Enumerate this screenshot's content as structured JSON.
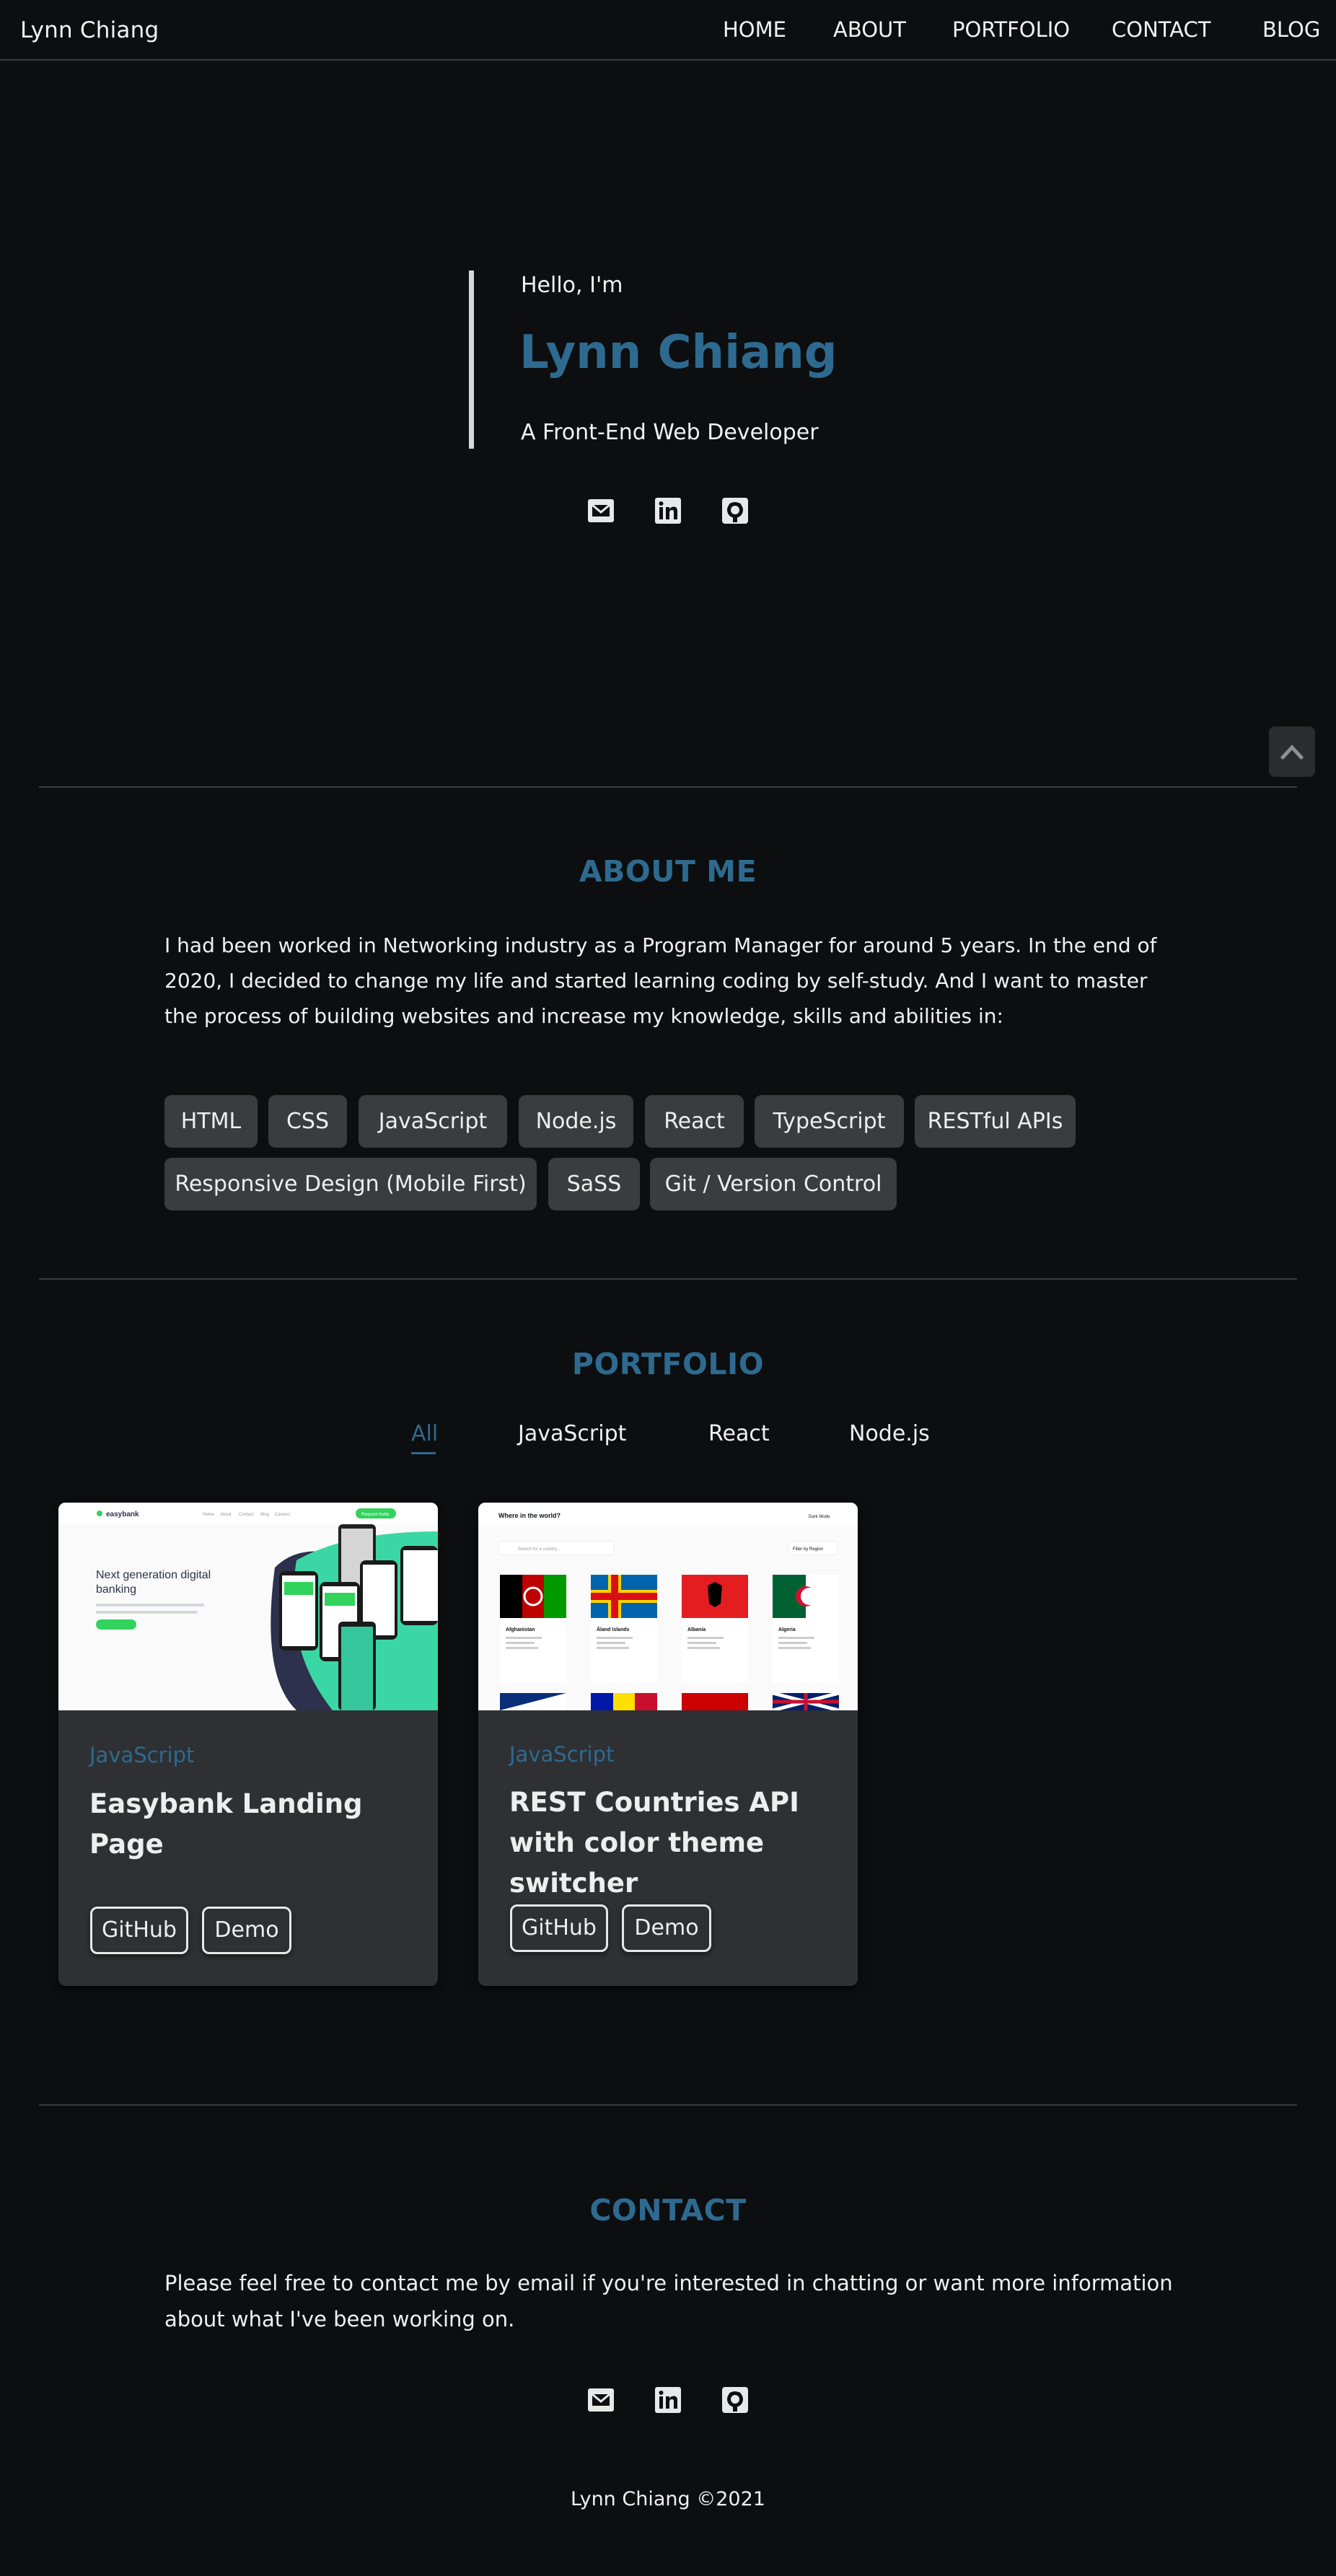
{
  "nav": {
    "brand": "Lynn Chiang",
    "links": [
      "HOME",
      "ABOUT",
      "PORTFOLIO",
      "CONTACT",
      "BLOG"
    ]
  },
  "hero": {
    "greeting": "Hello, I'm",
    "name": "Lynn Chiang",
    "role": "A Front-End Web Developer",
    "social_icons": [
      "email-icon",
      "linkedin-icon",
      "github-icon"
    ]
  },
  "about": {
    "title": "ABOUT ME",
    "text": "I had been worked in Networking industry as a Program Manager for around 5 years. In the end of 2020, I decided to change my life and started learning coding by self-study. And I want to master the process of building websites and increase my knowledge, skills and abilities in:",
    "skills": [
      "HTML",
      "CSS",
      "JavaScript",
      "Node.js",
      "React",
      "TypeScript",
      "RESTful APIs",
      "Responsive Design (Mobile First)",
      "SaSS",
      "Git / Version Control"
    ]
  },
  "portfolio": {
    "title": "PORTFOLIO",
    "filters": [
      "All",
      "JavaScript",
      "React",
      "Node.js"
    ],
    "active_filter": "All",
    "cards": [
      {
        "category": "JavaScript",
        "title": "Easybank Landing Page",
        "buttons": [
          "GitHub",
          "Demo"
        ],
        "preview": {
          "logo": "easybank",
          "nav": [
            "Home",
            "About",
            "Contact",
            "Blog",
            "Careers"
          ],
          "cta": "Request Invite",
          "headline": "Next generation digital banking"
        }
      },
      {
        "category": "JavaScript",
        "title": "REST Countries API with color theme switcher",
        "buttons": [
          "GitHub",
          "Demo"
        ],
        "preview": {
          "header": "Where in the world?",
          "mode": "Dark Mode",
          "search_placeholder": "Search for a country...",
          "filter": "Filter by Region",
          "countries": [
            "Afghanistan",
            "Åland Islands",
            "Albania",
            "Algeria"
          ]
        }
      }
    ]
  },
  "contact": {
    "title": "CONTACT",
    "text": "Please feel free to contact me by email if you're interested in chatting or want more information about what I've been working on."
  },
  "footer": {
    "text": "Lynn Chiang ©2021"
  },
  "colors": {
    "background": "#0c0e10",
    "accent": "#2e6a8f",
    "skill_chip": "#3a3c40",
    "card": "#2e3033"
  }
}
